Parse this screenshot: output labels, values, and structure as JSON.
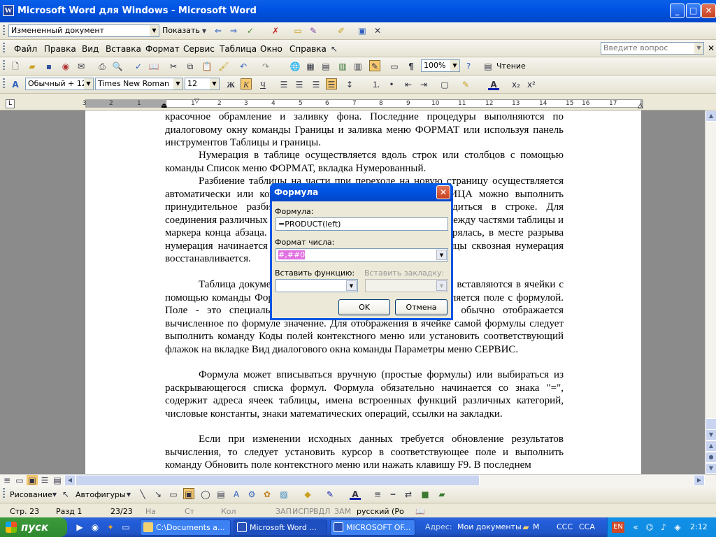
{
  "window": {
    "title": "Microsoft  Word для Windows - Microsoft Word",
    "app_icon": "W"
  },
  "reviewing_bar": {
    "display_value": "Измененный документ",
    "show_label": "Показать"
  },
  "menu": {
    "items": [
      "Файл",
      "Правка",
      "Вид",
      "Вставка",
      "Формат",
      "Сервис",
      "Таблица",
      "Окно",
      "Справка"
    ],
    "ask_placeholder": "Введите вопрос"
  },
  "standard_bar": {
    "zoom": "100%",
    "reading_label": "Чтение"
  },
  "format_bar": {
    "style": "Обычный + 12 г",
    "font": "Times New Roman",
    "size": "12"
  },
  "ruler": {
    "ticks": [
      "3",
      "2",
      "1",
      "1",
      "2",
      "3",
      "4",
      "5",
      "6",
      "7",
      "8",
      "9",
      "10",
      "11",
      "12",
      "13",
      "14",
      "15",
      "16",
      "17"
    ]
  },
  "document": {
    "p1": "красочное обрамление и заливку фона. Последние процедуры выполняются по диалоговому окну команды Границы и заливка меню ФОРМАТ или используя панель инструментов Таблицы и границы.",
    "p2": "Нумерация в таблице осуществляется вдоль строк или столбцов с помощью команды Список меню ФОРМАТ, вкладка Нумерованный.",
    "p3": "Разбиение таблицы на части при переходе на новую страницу осуществляется автоматически или командой Разбить таблицу меню ТАБЛИЦА можно выполнить принудительное разбиение таблицы, курсор должен находиться в строке. Для соединения различных частей таблицы выполняется удаление между частями таблицы и маркера конца абзаца. При этом, если строка заголовка повторялась, в месте разрыва нумерация начинается заново, для соединенных частей таблицы сквозная нумерация восстанавливается.",
    "p4": "Таблица документа может содержать формулы, которые вставляются в ячейки с помощью команды Формула меню ТАБЛИЦА. В ячейку вставляется поле с формулой. Поле - это специальная команда - кода поля. В ячейке обычно отображается вычисленное по формуле значение. Для отображения в ячейке самой формулы следует выполнить команду Коды полей контекстного меню или установить соответствующий флажок на вкладке Вид диалогового окна команды Параметры меню СЕРВИС.",
    "p5": "Формула может вписываться вручную (простые формулы) или выбираться из раскрывающегося списка формул. Формула обязательно начинается со знака \"=\", содержит адреса ячеек таблицы, имена встроенных функций различных категорий, числовые константы, знаки математических операций, ссылки на закладки.",
    "p6": "Если при изменении исходных данных требуется обновление результатов вычисления, то следует установить курсор в соответствующее поле и выполнить команду Обновить поле контекстного меню или нажать клавишу F9. В последнем"
  },
  "dialog": {
    "title": "Формула",
    "formula_label": "Формула:",
    "formula_value": "=PRODUCT(left)",
    "format_label": "Формат числа:",
    "format_value": "#,##0",
    "paste_function_label": "Вставить функцию:",
    "paste_bookmark_label": "Вставить закладку:",
    "ok": "OK",
    "cancel": "Отмена"
  },
  "drawing_bar": {
    "draw_label": "Рисование",
    "autoshapes_label": "Автофигуры"
  },
  "status": {
    "page": "Стр. 23",
    "section": "Разд 1",
    "pages": "23/23",
    "at": "На",
    "line": "Ст",
    "col": "Кол",
    "rec": "ЗАП",
    "trk": "ИСПР",
    "ext": "ВДЛ",
    "ovr": "ЗАМ",
    "lang": "русский (Ро"
  },
  "taskbar": {
    "start": "пуск",
    "tasks": [
      "C:\\Documents a...",
      "Microsoft  Word ...",
      "MICROSOFT OF..."
    ],
    "address_label": "Адрес:",
    "address_value": "Мои документы",
    "quick_items": [
      "М",
      "ССС",
      "ССА"
    ],
    "lang": "EN",
    "clock": "2:12"
  },
  "colors": {
    "titlebar": "#0054e3",
    "accent_pink": "#e070e0",
    "taskbar": "#245edb"
  }
}
